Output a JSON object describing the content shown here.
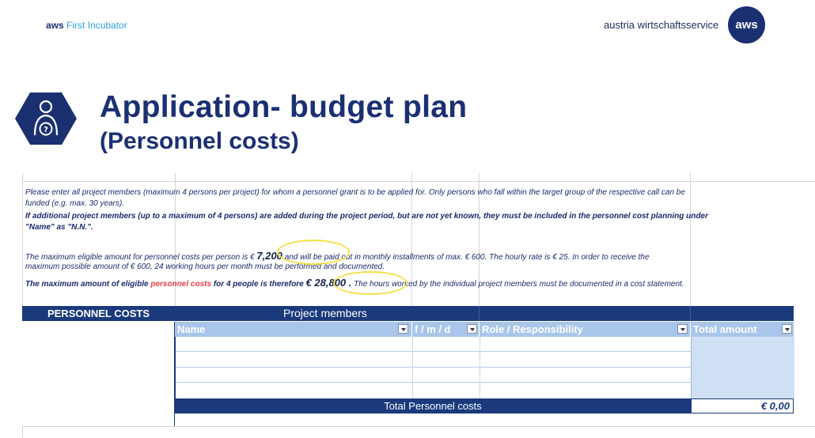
{
  "header": {
    "brand_short": "aws",
    "brand_program": "First Incubator",
    "org_name": "austria wirtschaftsservice",
    "logo_text": "aws"
  },
  "page": {
    "title": "Application- budget plan",
    "subtitle": "(Personnel costs)"
  },
  "info": {
    "line1": "Please enter all project members (maximum 4 persons per project) for whom a personnel grant is to be applied for. Only persons who fall within the target group of the respective call can be",
    "line2": "funded (e.g. max. 30 years).",
    "line3": "If additional project members (up to a maximum of 4 persons) are added during the project period, but are not yet known, they must be included in the personnel cost planning under",
    "line4": "\"Name\" as \"N.N.\".",
    "line5_a": "The maximum eligible amount for personnel costs per person is €",
    "line5_amount": "7,200",
    "line5_b": "and will be paid out in monthly installments of max. € 600. The hourly rate is € 25. In order to receive the",
    "line6": "maximum possible amount of € 600, 24 working hours per month must be performed and documented.",
    "line7_a": "The maximum amount of eligible",
    "line7_red": "personnel costs",
    "line7_b": "for 4 people is therefore",
    "line7_amount": "€ 28,800 .",
    "line7_c": "The hours worked by the individual project members must be documented in a cost statement."
  },
  "table": {
    "section_label": "PERSONNEL COSTS",
    "group_label": "Project members",
    "columns": [
      "Name",
      "f / m / d",
      "Role / Responsibility",
      "Total amount"
    ],
    "total_label": "Total Personnel costs",
    "total_value": "€ 0,00"
  },
  "colors": {
    "navy": "#1b2f73",
    "band": "#1a3a7c",
    "header_fill": "#a9c6ea",
    "amount_fill": "#cfe0f4",
    "highlight": "#f2e14a",
    "accent_red": "#e8404a",
    "accent_cyan": "#2aa3dc"
  },
  "icons": {
    "title_icon": "person-question-icon"
  }
}
